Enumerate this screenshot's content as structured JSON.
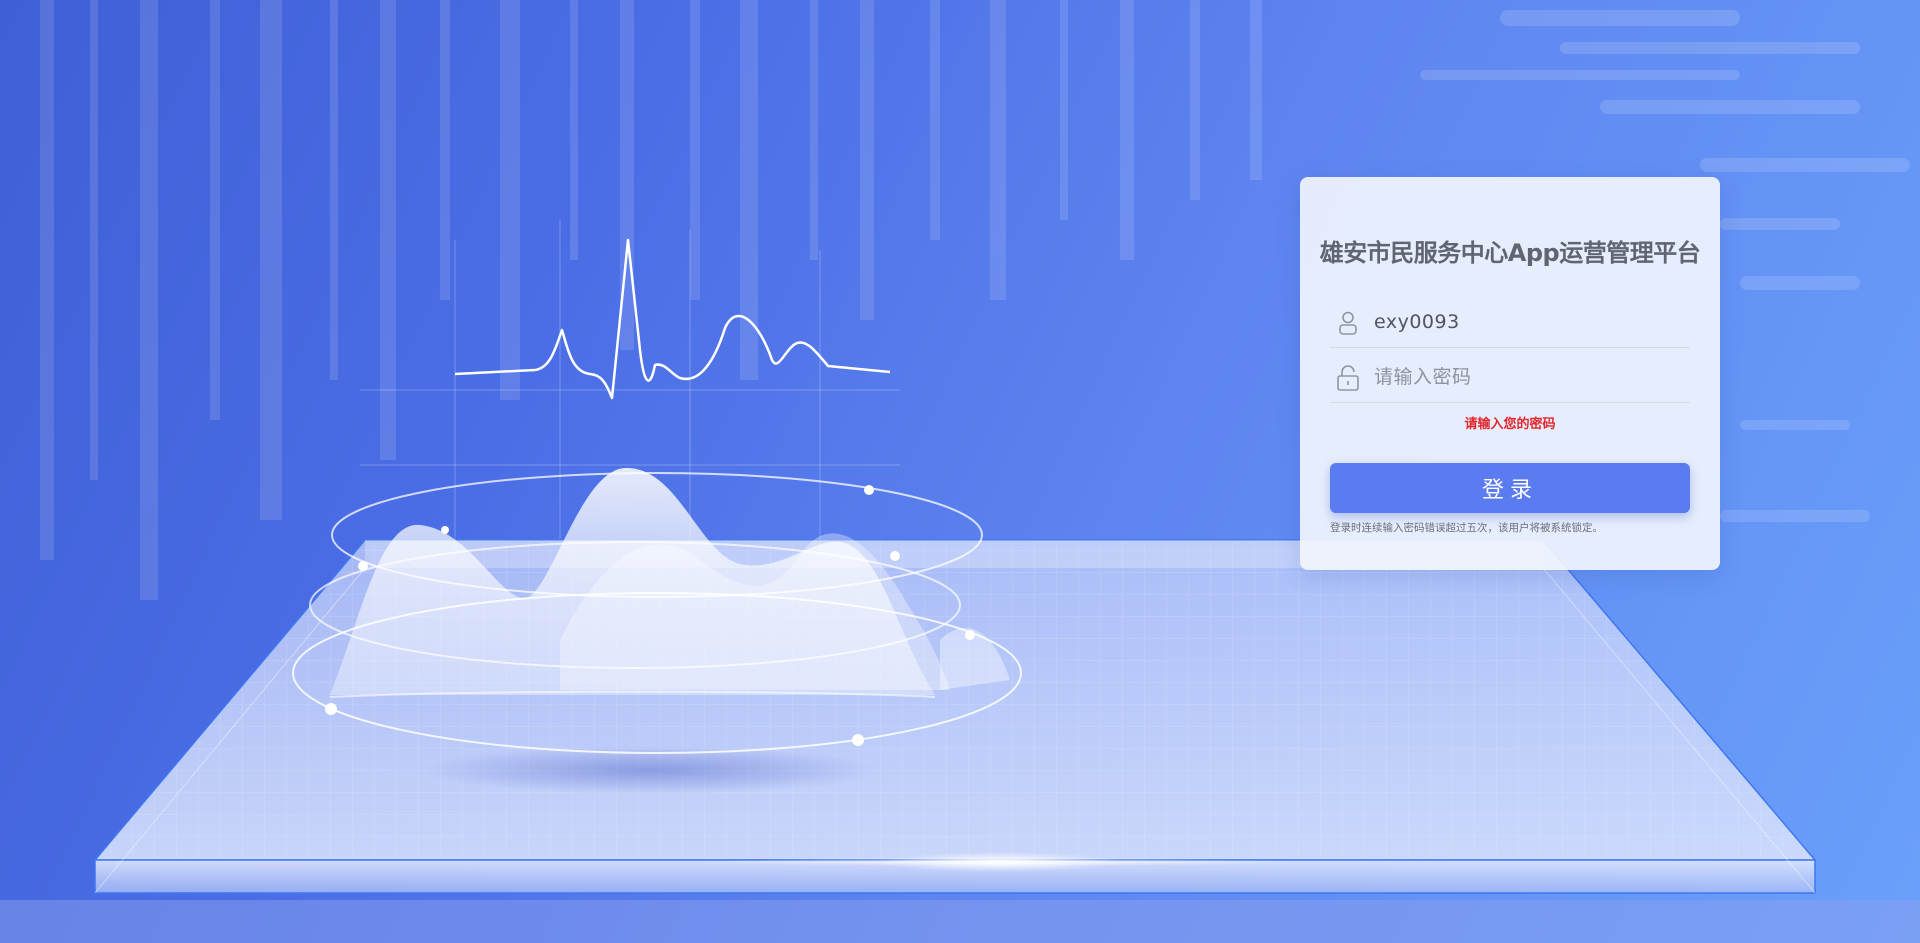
{
  "login": {
    "title": "雄安市民服务中心App运营管理平台",
    "username": {
      "value": "exy0093",
      "icon": "user-icon"
    },
    "password": {
      "value": "",
      "placeholder": "请输入密码",
      "icon": "lock-icon"
    },
    "error_message": "请输入您的密码",
    "submit_label": "登录",
    "lockout_note": "登录时连续输入密码错误超过五次，该用户将被系统锁定。"
  },
  "colors": {
    "background_start": "#3f5fd6",
    "background_end": "#6aa0fb",
    "button": "#5b7cf0",
    "error": "#e3262b",
    "title": "#5f6672"
  }
}
